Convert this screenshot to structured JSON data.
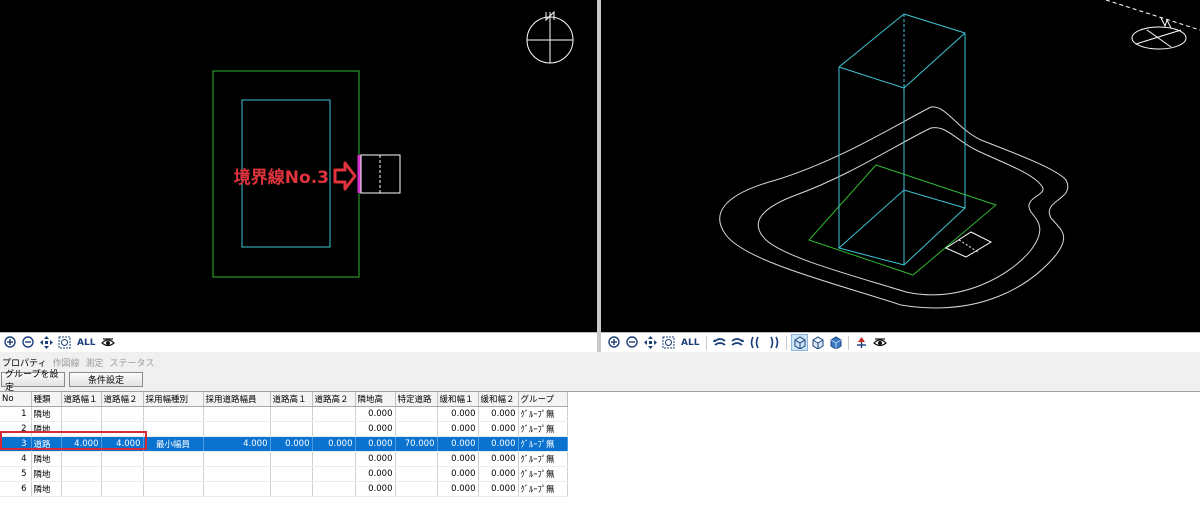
{
  "viewport_left": {
    "annotation": "境界線No.3",
    "compass_label": "N"
  },
  "toolbar_left": {
    "all_label": "ALL",
    "icons": [
      "zoom-in-icon",
      "zoom-out-icon",
      "pan-icon",
      "zoom-window-icon",
      "eye-icon"
    ]
  },
  "toolbar_right": {
    "all_label": "ALL",
    "icons": [
      "zoom-in-icon",
      "zoom-out-icon",
      "pan-icon",
      "zoom-window-icon",
      "rotate-left-icon",
      "rotate-right-icon",
      "rotate-down-icon",
      "rotate-up-icon",
      "wireframe-view-icon",
      "box-view-icon",
      "solid-view-icon",
      "direction-icon",
      "eye-icon"
    ]
  },
  "tabs": [
    {
      "label": "プロパティ",
      "active": true
    },
    {
      "label": "作図線",
      "active": false
    },
    {
      "label": "測定",
      "active": false
    },
    {
      "label": "ステータス",
      "active": false
    }
  ],
  "buttons": {
    "set_group": "グループを設定",
    "conditions": "条件設定"
  },
  "table": {
    "columns": [
      "No",
      "種類",
      "道路幅１",
      "道路幅２",
      "採用幅種別",
      "採用道路幅員",
      "道路高１",
      "道路高２",
      "隣地高",
      "特定道路",
      "緩和幅１",
      "緩和幅２",
      "グループ"
    ],
    "rows": [
      [
        "1",
        "隣地",
        "",
        "",
        "",
        "",
        "",
        "",
        "0.000",
        "",
        "0.000",
        "0.000",
        "ｸﾞﾙｰﾌﾟ無"
      ],
      [
        "2",
        "隣地",
        "",
        "",
        "",
        "",
        "",
        "",
        "0.000",
        "",
        "0.000",
        "0.000",
        "ｸﾞﾙｰﾌﾟ無"
      ],
      [
        "3",
        "道路",
        "4.000",
        "4.000",
        "最小幅員",
        "4.000",
        "0.000",
        "0.000",
        "0.000",
        "70.000",
        "0.000",
        "0.000",
        "ｸﾞﾙｰﾌﾟ無"
      ],
      [
        "4",
        "隣地",
        "",
        "",
        "",
        "",
        "",
        "",
        "0.000",
        "",
        "0.000",
        "0.000",
        "ｸﾞﾙｰﾌﾟ無"
      ],
      [
        "5",
        "隣地",
        "",
        "",
        "",
        "",
        "",
        "",
        "0.000",
        "",
        "0.000",
        "0.000",
        "ｸﾞﾙｰﾌﾟ無"
      ],
      [
        "6",
        "隣地",
        "",
        "",
        "",
        "",
        "",
        "",
        "0.000",
        "",
        "0.000",
        "0.000",
        "ｸﾞﾙｰﾌﾟ無"
      ]
    ],
    "selected_row": 2
  },
  "colors": {
    "site_green": "#2fb52f",
    "building_cyan": "#3fc6d8",
    "annotation_red": "#e0333d",
    "boundary_magenta": "#d62fd0",
    "selection_blue": "#0a73cf"
  }
}
